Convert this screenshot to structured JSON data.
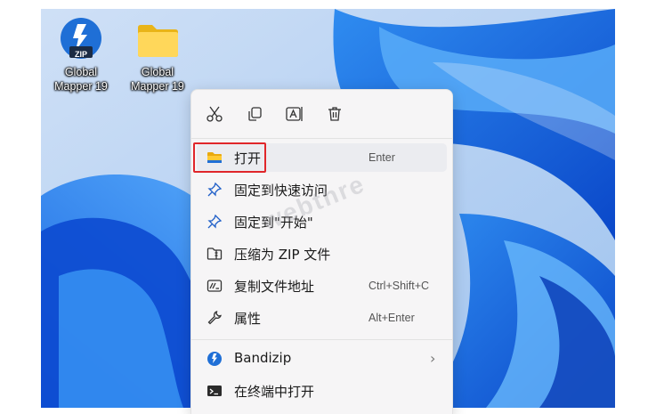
{
  "desktop": {
    "icons": [
      {
        "label_line1": "Global",
        "label_line2": "Mapper 19",
        "badge": "ZIP",
        "icon": "bandizip-zip-icon"
      },
      {
        "label_line1": "Global",
        "label_line2": "Mapper 19",
        "icon": "folder-icon"
      }
    ]
  },
  "watermark": "webthre",
  "context_menu": {
    "toolbar": [
      {
        "name": "cut-icon"
      },
      {
        "name": "copy-icon"
      },
      {
        "name": "rename-icon"
      },
      {
        "name": "delete-icon"
      }
    ],
    "items": [
      {
        "label": "打开",
        "shortcut": "Enter",
        "icon": "folder-open-icon"
      },
      {
        "label": "固定到快速访问",
        "shortcut": "",
        "icon": "pin-icon"
      },
      {
        "label": "固定到\"开始\"",
        "shortcut": "",
        "icon": "pin-start-icon"
      },
      {
        "label": "压缩为 ZIP 文件",
        "shortcut": "",
        "icon": "zip-archive-icon"
      },
      {
        "label": "复制文件地址",
        "shortcut": "Ctrl+Shift+C",
        "icon": "copy-path-icon"
      },
      {
        "label": "属性",
        "shortcut": "Alt+Enter",
        "icon": "wrench-icon"
      },
      {
        "label": "Bandizip",
        "shortcut": "",
        "icon": "bandizip-icon",
        "submenu_indicator": "›"
      },
      {
        "label": "在终端中打开",
        "shortcut": "",
        "icon": "terminal-icon"
      }
    ]
  },
  "colors": {
    "accent_blue": "#1f6fd6",
    "highlight_red": "#e0262a",
    "menu_bg": "#f6f5f6"
  }
}
